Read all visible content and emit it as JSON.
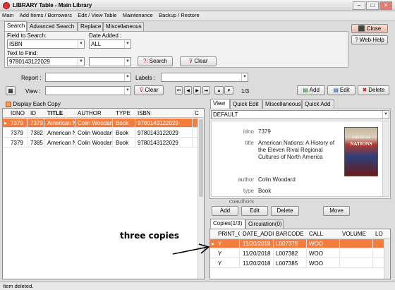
{
  "window": {
    "title": "LIBRARY Table - Main Library"
  },
  "menu": [
    "Main",
    "Add Items / Borrowers",
    "Edit / View Table",
    "Maintenance",
    "Backup / Restore"
  ],
  "search_tabs": [
    "Search",
    "Advanced Search",
    "Replace",
    "Miscellaneous"
  ],
  "search": {
    "field_label": "Field to Search:",
    "field_value": "ISBN",
    "date_label": "Date Added :",
    "date_value": "ALL",
    "text_label": "Text to Find:",
    "text_value": "9780143122029",
    "search_btn": "Search",
    "clear_btn": "Clear"
  },
  "top_buttons": {
    "close": "Close",
    "web_help": "Web Help"
  },
  "filters": {
    "report_label": "Report :",
    "labels_label": "Labels :",
    "view_label": "View :",
    "clear_btn": "Clear",
    "counter": "1/3"
  },
  "actions": {
    "add": "Add",
    "edit": "Edit",
    "delete": "Delete"
  },
  "display_each_copy": "Display Each Copy",
  "grid": {
    "headers": [
      "IDNO",
      "ID",
      "TITLE",
      "AUTHOR",
      "TYPE",
      "ISBN",
      "C"
    ],
    "rows": [
      [
        "7379",
        "7379",
        "American N",
        "Colin Woodan",
        "Book",
        "9780143122029",
        ""
      ],
      [
        "7379",
        "7382",
        "American N",
        "Colin Woodan",
        "Book",
        "9780143122029",
        ""
      ],
      [
        "7379",
        "7385",
        "American N",
        "Colin Woodan",
        "Book",
        "9780143122029",
        ""
      ]
    ]
  },
  "view_tabs": [
    "View",
    "Quick Edit",
    "Miscellaneous",
    "Quick Add"
  ],
  "view_select": "DEFAULT",
  "record": [
    {
      "k": "idno",
      "v": "7379"
    },
    {
      "k": "title",
      "v": "American Nations: A History of the Eleven Rival Regional Cultures of North America"
    },
    {
      "k": "author",
      "v": "Colin Woodard"
    },
    {
      "k": "type",
      "v": "Book"
    },
    {
      "k": "coauthors",
      "v": ""
    }
  ],
  "cover": {
    "text1": "AMERICAN",
    "text2": "NATIONS"
  },
  "copy_buttons": {
    "add": "Add",
    "edit": "Edit",
    "delete": "Delete",
    "move": "Move"
  },
  "copy_tabs": [
    "Copies(1/3)",
    "Circulation(0)"
  ],
  "copies": {
    "headers": [
      "PRINT_C",
      "DATE_ADDI",
      "BARCODE",
      "CALL",
      "VOLUME",
      "LO"
    ],
    "rows": [
      [
        "Y",
        "11/20/2018",
        "L007379",
        "WOO",
        "",
        ""
      ],
      [
        "Y",
        "11/20/2018",
        "L007382",
        "WOO",
        "",
        ""
      ],
      [
        "Y",
        "11/20/2018",
        "L007385",
        "WOO",
        "",
        ""
      ]
    ]
  },
  "annotation": "three copies",
  "status": "Item deleted.",
  "colors": {
    "selected": "#f47c3c",
    "accent_red": "#d33"
  }
}
